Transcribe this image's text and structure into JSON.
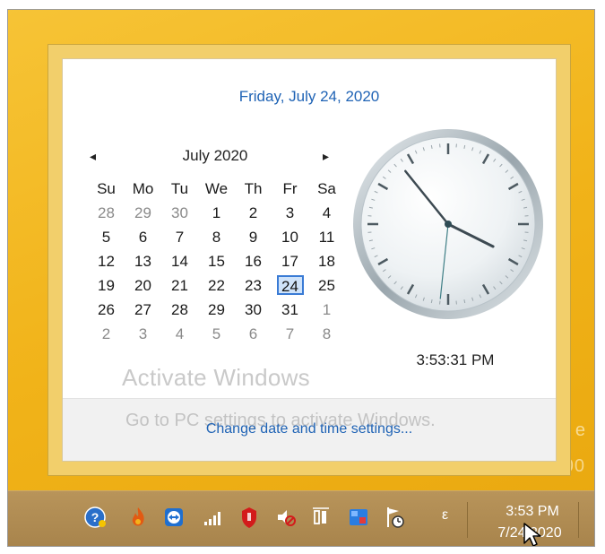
{
  "flyout": {
    "full_date": "Friday, July 24, 2020",
    "month_title": "July 2020",
    "prev_glyph": "◂",
    "next_glyph": "▸",
    "weekdays": [
      "Su",
      "Mo",
      "Tu",
      "We",
      "Th",
      "Fr",
      "Sa"
    ],
    "weeks": [
      [
        "28",
        "29",
        "30",
        "1",
        "2",
        "3",
        "4"
      ],
      [
        "5",
        "6",
        "7",
        "8",
        "9",
        "10",
        "11"
      ],
      [
        "12",
        "13",
        "14",
        "15",
        "16",
        "17",
        "18"
      ],
      [
        "19",
        "20",
        "21",
        "22",
        "23",
        "24",
        "25"
      ],
      [
        "26",
        "27",
        "28",
        "29",
        "30",
        "31",
        "1"
      ],
      [
        "2",
        "3",
        "4",
        "5",
        "6",
        "7",
        "8"
      ]
    ],
    "clock_time": "3:53:31 PM",
    "clock": {
      "hours": 3,
      "minutes": 53,
      "seconds": 31
    },
    "change_link": "Change date and time settings..."
  },
  "watermark": {
    "title": "Activate Windows",
    "subtitle": "Go to PC settings to activate Windows."
  },
  "taskbar": {
    "time": "3:53 PM",
    "date": "7/24/2020",
    "language_indicator": "ε",
    "icons": [
      "help-icon",
      "fire-icon",
      "teamviewer-icon",
      "signal-icon",
      "shield-icon",
      "volume-muted-icon",
      "network-icon",
      "defender-icon",
      "flag-clock-icon"
    ]
  },
  "colors": {
    "accent": "#1f63b5",
    "desktop": "#f3b51b",
    "today_border": "#3a7bd5"
  }
}
